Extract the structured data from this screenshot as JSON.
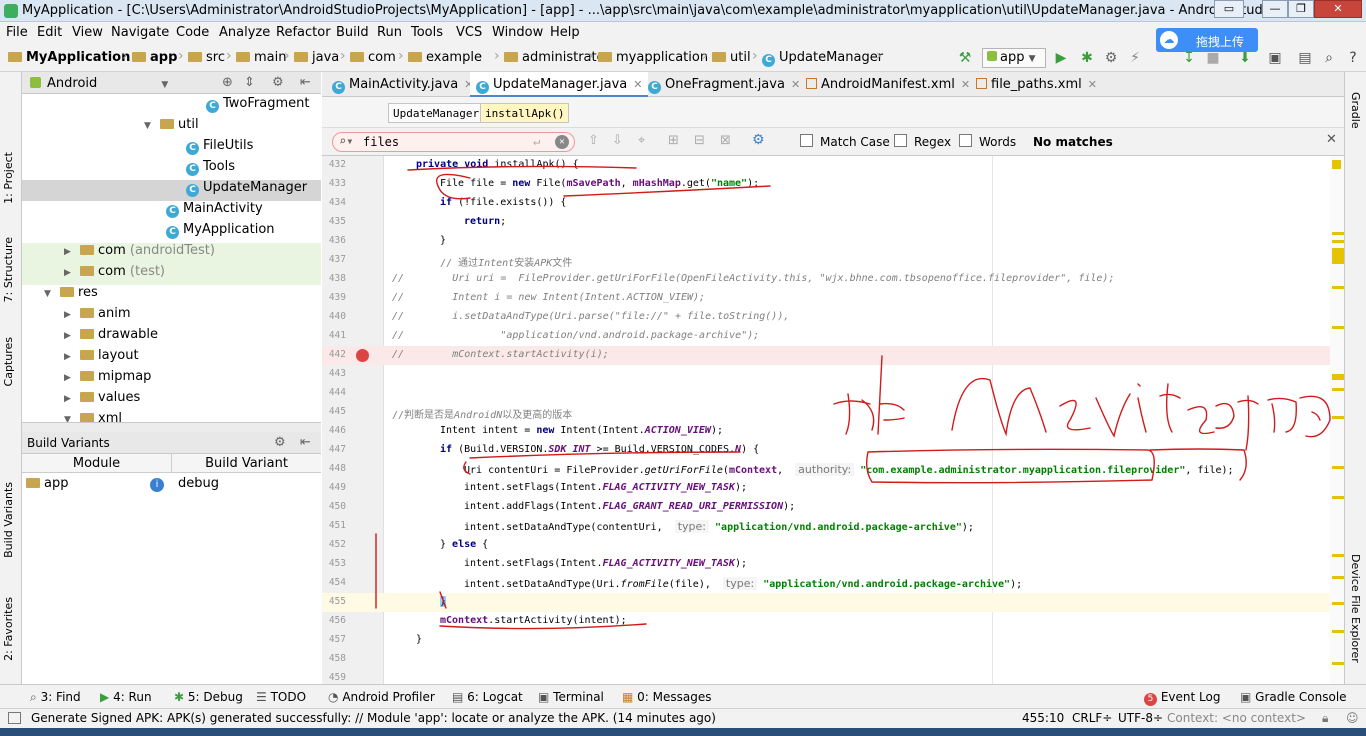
{
  "window": {
    "title": "MyApplication - [C:\\Users\\Administrator\\AndroidStudioProjects\\MyApplication] - [app] - ...\\app\\src\\main\\java\\com\\example\\administrator\\myapplication\\util\\UpdateManager.java - Android Studio 3.0.1"
  },
  "menu": [
    "File",
    "Edit",
    "View",
    "Navigate",
    "Code",
    "Analyze",
    "Refactor",
    "Build",
    "Run",
    "Tools",
    "VCS",
    "Window",
    "Help"
  ],
  "breadcrumbs": [
    "MyApplication",
    "app",
    "src",
    "main",
    "java",
    "com",
    "example",
    "administrator",
    "myapplication",
    "util",
    "UpdateManager"
  ],
  "toolbar": {
    "run_config": "app"
  },
  "overlay": {
    "upload_label": "拖拽上传"
  },
  "left_tool_tabs": [
    "1: Project",
    "7: Structure",
    "Captures",
    "Build Variants",
    "2: Favorites"
  ],
  "right_tool_tabs": [
    "Gradle",
    "Device File Explorer"
  ],
  "project": {
    "view_label": "Android",
    "tree": [
      {
        "label": "TwoFragment",
        "type": "class"
      },
      {
        "label": "util",
        "type": "folder"
      },
      {
        "label": "FileUtils",
        "type": "class"
      },
      {
        "label": "Tools",
        "type": "class"
      },
      {
        "label": "UpdateManager",
        "type": "class"
      },
      {
        "label": "MainActivity",
        "type": "class"
      },
      {
        "label": "MyApplication",
        "type": "class"
      },
      {
        "label": "com",
        "suffix": " (androidTest)",
        "type": "folder"
      },
      {
        "label": "com",
        "suffix": " (test)",
        "type": "folder"
      },
      {
        "label": "res",
        "type": "folder"
      },
      {
        "label": "anim",
        "type": "folder"
      },
      {
        "label": "drawable",
        "type": "folder"
      },
      {
        "label": "layout",
        "type": "folder"
      },
      {
        "label": "mipmap",
        "type": "folder"
      },
      {
        "label": "values",
        "type": "folder"
      },
      {
        "label": "xml",
        "type": "folder"
      }
    ]
  },
  "build_variants": {
    "title": "Build Variants",
    "col_module": "Module",
    "col_variant": "Build Variant",
    "module": "app",
    "variant": "debug"
  },
  "tabs": [
    {
      "label": "MainActivity.java"
    },
    {
      "label": "UpdateManager.java"
    },
    {
      "label": "OneFragment.java"
    },
    {
      "label": "AndroidManifest.xml"
    },
    {
      "label": "file_paths.xml"
    }
  ],
  "editor_breadcrumb": [
    "UpdateManager",
    "installApk()"
  ],
  "find": {
    "query": "files",
    "match_case": "Match Case",
    "regex": "Regex",
    "words": "Words",
    "result": "No matches"
  },
  "code": {
    "lines": [
      "432",
      "433",
      "434",
      "435",
      "436",
      "437",
      "438",
      "439",
      "440",
      "441",
      "442",
      "443",
      "444",
      "445",
      "446",
      "447",
      "448",
      "449",
      "450",
      "451",
      "452",
      "453",
      "454",
      "455",
      "456",
      "457",
      "458",
      "459"
    ],
    "l432_kw1": "private",
    "l432_kw2": "void",
    "l432_rest": " installApk() {",
    "l433_a": "File file = ",
    "l433_new": "new",
    "l433_b": " File(",
    "l433_f1": "mSavePath",
    "l433_c": ", ",
    "l433_f2": "mHashMap",
    "l433_d": ".get(",
    "l433_s": "\"name\"",
    "l433_e": ");",
    "l434_kw": "if",
    "l434_rest": " (!file.exists()) {",
    "l435_kw": "return",
    "l435_rest": ";",
    "l436": "}",
    "l437_a": "// 通过",
    "l437_b": "Intent",
    "l437_c": "安装",
    "l437_d": "APK",
    "l437_e": "文件",
    "l438_a": "//",
    "l438_b": "        Uri uri =  FileProvider.getUriForFile(OpenFileActivity.this, \"wjx.bhne.com.tbsopenoffice.fileprovider\", file);",
    "l439_a": "//",
    "l439_b": "        Intent i = new Intent(Intent.ACTION_VIEW);",
    "l440_a": "//",
    "l440_b": "        i.setDataAndType(Uri.parse(\"file://\" + file.toString()),",
    "l441_a": "//",
    "l441_b": "                \"application/vnd.android.package-archive\");",
    "l442_a": "//",
    "l442_b": "        mContext.startActivity(i);",
    "l445_a": "//判断是否是",
    "l445_b": "AndroidN",
    "l445_c": "以及更高的版本",
    "l446_a": "Intent intent = ",
    "l446_new": "new",
    "l446_b": " Intent(Intent.",
    "l446_st": "ACTION_VIEW",
    "l446_c": ");",
    "l447_kw": "if",
    "l447_a": " (Build.VERSION.",
    "l447_st": "SDK_INT",
    "l447_b": " >= Build.VERSION_CODES.",
    "l447_n": "N",
    "l447_c": ") {",
    "l448_a": "Uri contentUri = FileProvider.",
    "l448_m": "getUriForFile",
    "l448_b": "(",
    "l448_f": "mContext",
    "l448_c": ",  ",
    "l448_hint": "authority:",
    "l448_s": "\"com.example.administrator.myapplication.fileprovider\"",
    "l448_d": ", file);",
    "l449_a": "intent.setFlags(Intent.",
    "l449_st": "FLAG_ACTIVITY_NEW_TASK",
    "l449_b": ");",
    "l450_a": "intent.addFlags(Intent.",
    "l450_st": "FLAG_GRANT_READ_URI_PERMISSION",
    "l450_b": ");",
    "l451_a": "intent.setDataAndType(contentUri,  ",
    "l451_hint": "type:",
    "l451_s": "\"application/vnd.android.package-archive\"",
    "l451_b": ");",
    "l452_a": "} ",
    "l452_kw": "else",
    "l452_b": " {",
    "l453_a": "intent.setFlags(Intent.",
    "l453_st": "FLAG_ACTIVITY_NEW_TASK",
    "l453_b": ");",
    "l454_a": "intent.setDataAndType(Uri.",
    "l454_m": "fromFile",
    "l454_b": "(file),  ",
    "l454_hint": "type:",
    "l454_s": "\"application/vnd.android.package-archive\"",
    "l454_c": ");",
    "l455": "}",
    "l456_f": "mContext",
    "l456_rest": ".startActivity(intent);",
    "l457": "}"
  },
  "bottom_tools": [
    {
      "label": "3: Find"
    },
    {
      "label": "4: Run"
    },
    {
      "label": "5: Debug"
    },
    {
      "label": "TODO"
    },
    {
      "label": "Android Profiler"
    },
    {
      "label": "6: Logcat"
    },
    {
      "label": "Terminal"
    },
    {
      "label": "0: Messages"
    },
    {
      "label": "Event Log",
      "badge": "5"
    },
    {
      "label": "Gradle Console"
    }
  ],
  "status": {
    "message": "Generate Signed APK: APK(s) generated successfully: // Module 'app': locate or analyze the APK. (14 minutes ago)",
    "position": "455:10",
    "line_sep": "CRLF÷",
    "encoding": "UTF-8÷",
    "context": "Context: <no context>"
  },
  "colors": {
    "accent": "#4a88c7",
    "string": "#008000",
    "keyword": "#000080",
    "static": "#660e7a",
    "annotation_ink": "#d11a1a"
  }
}
